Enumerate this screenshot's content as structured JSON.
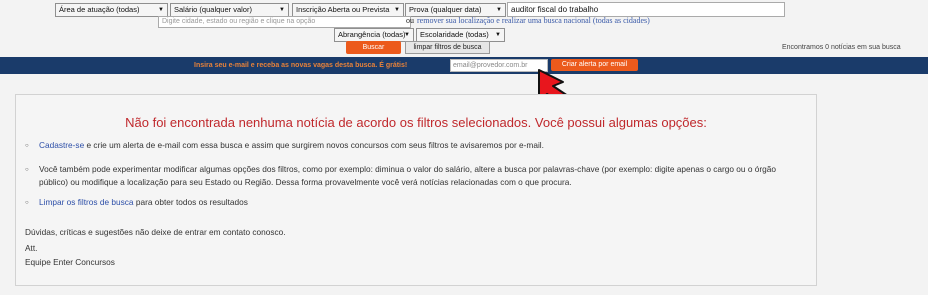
{
  "filters": {
    "area": "Área de atuação (todas)",
    "salary": "Salário (qualquer valor)",
    "enrollment": "Inscrição Aberta ou Prevista",
    "exam": "Prova (qualquer data)",
    "search_value": "auditor fiscal do trabalho",
    "location_placeholder": "Digite cidade, estado ou região e clique na opção",
    "or_text": "ou",
    "remove_location_link": "remover sua localização e realizar uma busca nacional (todas as cidades)",
    "scope": "Abrangência (todas)",
    "education": "Escolaridade (todas)",
    "search_button": "Buscar",
    "clear_button": "limpar filtros de busca",
    "results_count": "Encontramos 0 notícias em sua busca"
  },
  "alert_bar": {
    "text": "Insira seu e-mail e receba as novas vagas desta busca. É grátis!",
    "email_placeholder": "email@provedor.com.br",
    "create_button": "Criar alerta por email"
  },
  "notice": {
    "headline": "Não foi encontrada nenhuma notícia de acordo os filtros selecionados. Você possui algumas opções:",
    "option1_link": "Cadastre-se",
    "option1_rest": " e crie um alerta de e-mail com essa busca e assim que surgirem novos concursos com seus filtros te avisaremos por e-mail.",
    "option2": "Você também pode experimentar modificar algumas opções dos filtros, como por exemplo: diminua o valor do salário, altere a busca por palavras-chave (por exemplo: digite apenas o cargo ou o órgão público) ou modifique a localização para seu Estado ou Região. Dessa forma provavelmente você verá notícias relacionadas com o que procura.",
    "option3_link": "Limpar os filtros de busca",
    "option3_rest": " para obter todos os resultados",
    "feedback": "Dúvidas, críticas e sugestões não deixe de entrar em contato conosco.",
    "sign_off1": "Att.",
    "sign_off2": "Equipe Enter Concursos"
  },
  "colors": {
    "accent": "#ec5a1c",
    "bar": "#1a3b6a",
    "headline": "#c0282c",
    "link": "#2d4fa8"
  },
  "icons": {
    "pointer": "red-arrow-pointer-icon",
    "dropdown": "triangle-down"
  }
}
